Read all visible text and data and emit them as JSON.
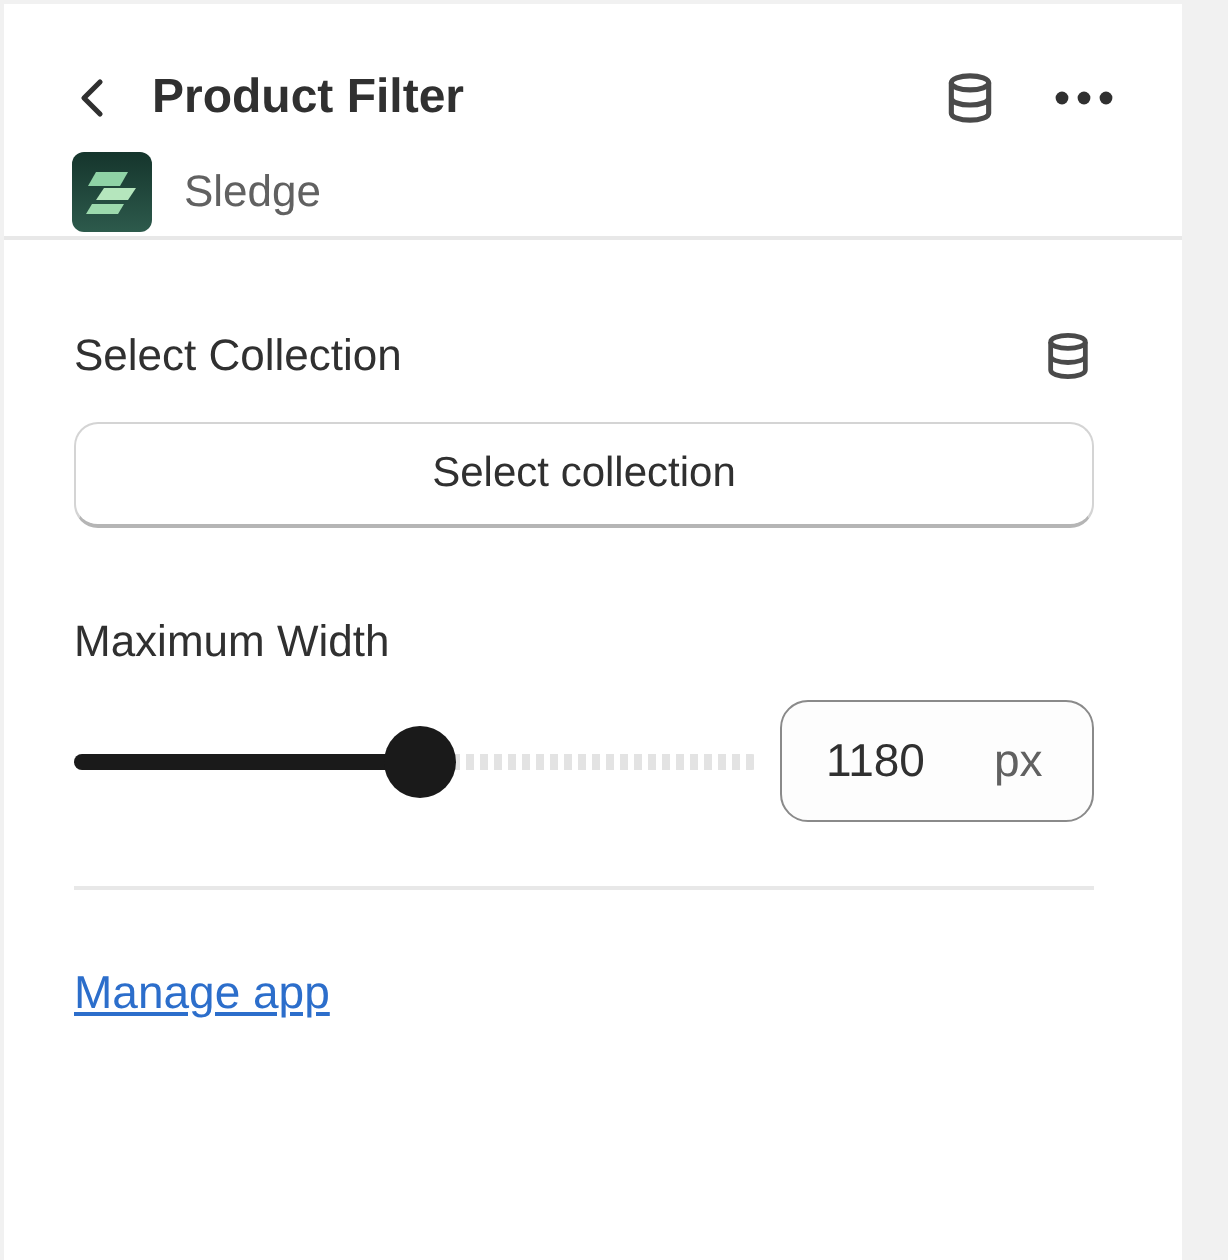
{
  "header": {
    "title": "Product Filter",
    "app_name": "Sledge"
  },
  "collection": {
    "label": "Select Collection",
    "button": "Select collection"
  },
  "max_width": {
    "label": "Maximum Width",
    "level": 0.505,
    "value": "1180",
    "unit": "px"
  },
  "link": "Manage app"
}
